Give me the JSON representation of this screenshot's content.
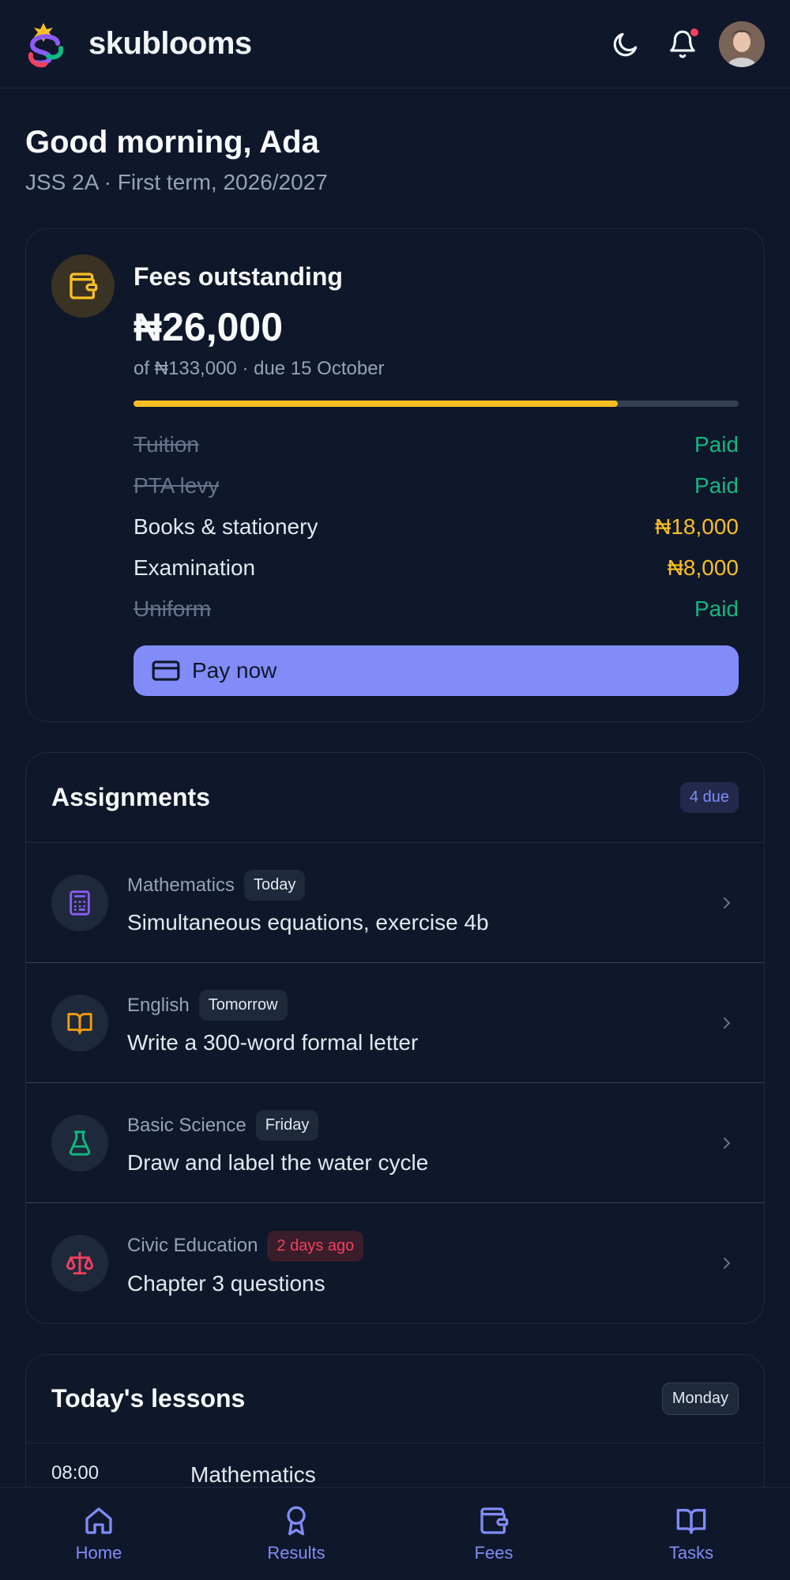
{
  "header": {
    "brand": "skublooms",
    "icons": [
      "moon-icon",
      "bell-icon",
      "avatar"
    ]
  },
  "greeting": {
    "title": "Good morning, Ada",
    "subtitle": "JSS 2A · First term, 2026/2027"
  },
  "fees": {
    "title": "Fees outstanding",
    "amount": "₦26,000",
    "subtitle": "of ₦133,000 · due 15 October",
    "progress_fraction": 0.8,
    "items": [
      {
        "name": "Tuition",
        "value": "Paid",
        "status": "paid"
      },
      {
        "name": "PTA levy",
        "value": "Paid",
        "status": "paid"
      },
      {
        "name": "Books & stationery",
        "value": "₦18,000",
        "status": "due"
      },
      {
        "name": "Examination",
        "value": "₦8,000",
        "status": "due"
      },
      {
        "name": "Uniform",
        "value": "Paid",
        "status": "paid"
      }
    ],
    "pay_label": "Pay now"
  },
  "assignments": {
    "title": "Assignments",
    "badge": "4 due",
    "items": [
      {
        "subject": "Mathematics",
        "tag": "Today",
        "title": "Simultaneous equations, exercise 4b",
        "icon": "calculator-icon",
        "color": "#8b5cf6",
        "late": false
      },
      {
        "subject": "English",
        "tag": "Tomorrow",
        "title": "Write a 300-word formal letter",
        "icon": "book-icon",
        "color": "#f59e0b",
        "late": false
      },
      {
        "subject": "Basic Science",
        "tag": "Friday",
        "title": "Draw and label the water cycle",
        "icon": "flask-icon",
        "color": "#10b981",
        "late": false
      },
      {
        "subject": "Civic Education",
        "tag": "2 days ago",
        "title": "Chapter 3 questions",
        "icon": "scale-icon",
        "color": "#f43f5e",
        "late": true
      }
    ]
  },
  "lessons": {
    "title": "Today's lessons",
    "badge": "Monday",
    "items": [
      {
        "time": "08:00",
        "subject": "Mathematics"
      }
    ]
  },
  "nav": {
    "items": [
      {
        "label": "Home",
        "icon": "home-icon"
      },
      {
        "label": "Results",
        "icon": "award-icon"
      },
      {
        "label": "Fees",
        "icon": "wallet-icon"
      },
      {
        "label": "Tasks",
        "icon": "book-open-icon"
      }
    ]
  },
  "colors": {
    "background": "#0f172a",
    "accent": "#818cf8",
    "warning": "#fbbf24",
    "success": "#10b981",
    "danger": "#f43f5e"
  }
}
